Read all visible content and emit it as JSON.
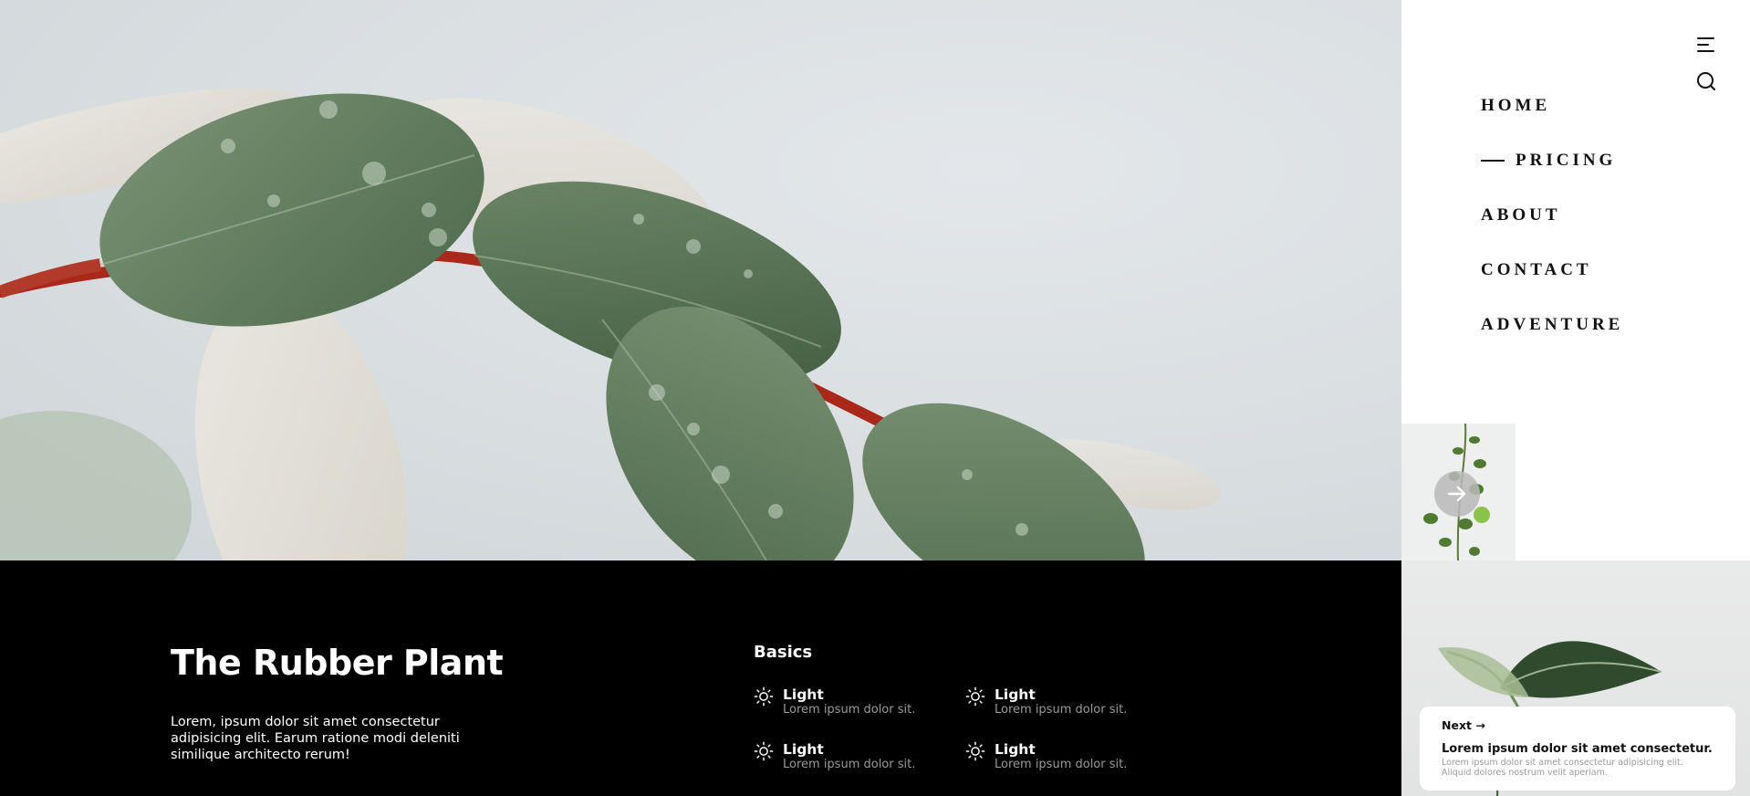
{
  "nav": {
    "items": [
      {
        "label": "HOME",
        "active": false
      },
      {
        "label": "PRICING",
        "active": true
      },
      {
        "label": "ABOUT",
        "active": false
      },
      {
        "label": "CONTACT",
        "active": false
      },
      {
        "label": "ADVENTURE",
        "active": false
      }
    ],
    "menu_icon": "hamburger-menu-icon",
    "search_icon": "search-icon"
  },
  "thumbnail": {
    "arrow_icon": "arrow-right-icon"
  },
  "info": {
    "title": "The Rubber Plant",
    "description": "Lorem, ipsum dolor sit amet consectetur adipisicing elit. Earum ratione modi deleniti similique architecto rerum!",
    "basics": {
      "title": "Basics",
      "features": [
        {
          "name": "Light",
          "description": "Lorem ipsum dolor sit.",
          "icon": "sun-icon"
        },
        {
          "name": "Light",
          "description": "Lorem ipsum dolor sit.",
          "icon": "sun-icon"
        },
        {
          "name": "Light",
          "description": "Lorem ipsum dolor sit.",
          "icon": "sun-icon"
        },
        {
          "name": "Light",
          "description": "Lorem ipsum dolor sit.",
          "icon": "sun-icon"
        }
      ]
    }
  },
  "next_card": {
    "label": "Next →",
    "headline": "Lorem ipsum dolor sit amet consectetur.",
    "body": "Lorem ipsum dolor sit amet consectetur adipisicing elit. Aliquid dolores nostrum velit aperiam."
  },
  "colors": {
    "info_background": "#000000",
    "muted_text": "#9a9a9a",
    "leaf_green": "#5f7a5c",
    "stem_red": "#a9281a"
  }
}
